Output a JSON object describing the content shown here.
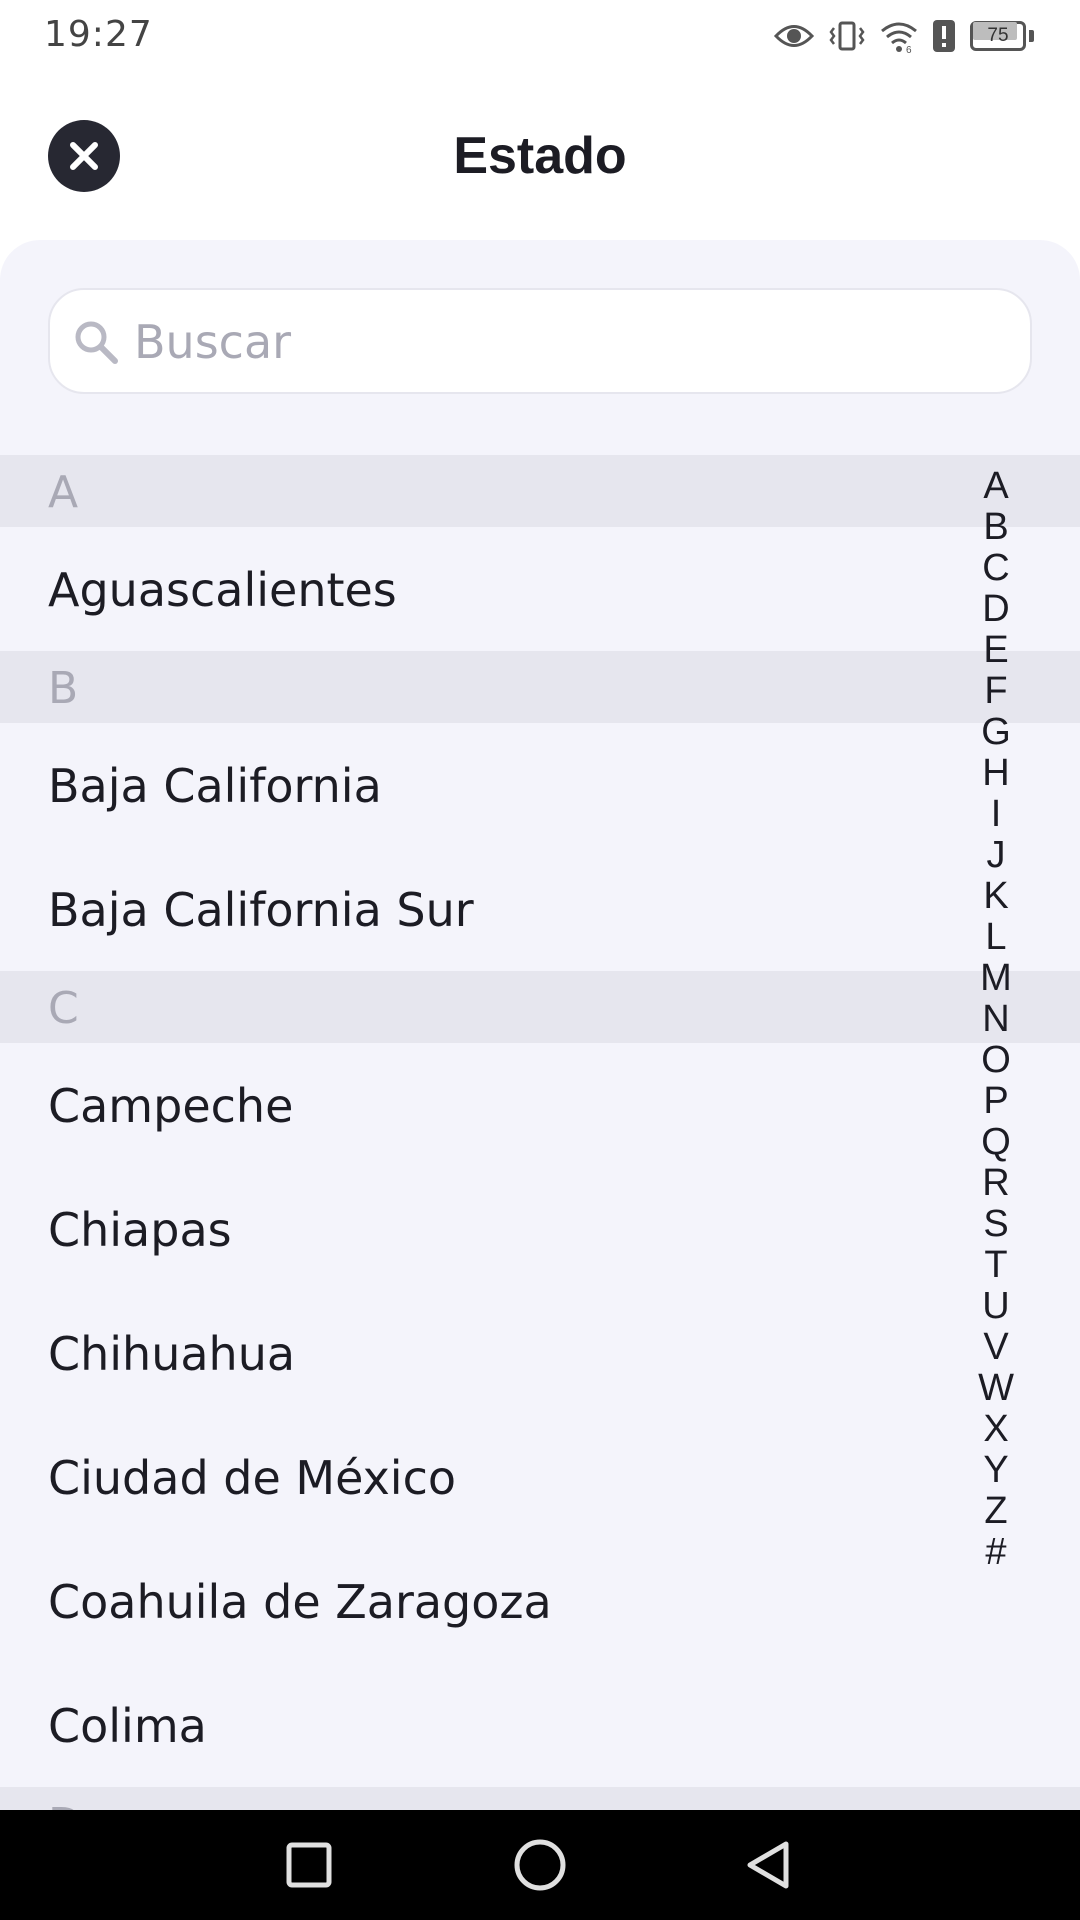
{
  "status_bar": {
    "time": "19:27",
    "battery_level": "75",
    "icons": [
      "eye-icon",
      "vibrate-icon",
      "wifi-icon",
      "alert-icon",
      "battery-icon"
    ]
  },
  "header": {
    "title": "Estado",
    "close_icon": "close-icon"
  },
  "search": {
    "placeholder": "Buscar",
    "value": ""
  },
  "sections": [
    {
      "letter": "A",
      "items": [
        "Aguascalientes"
      ]
    },
    {
      "letter": "B",
      "items": [
        "Baja California",
        "Baja California Sur"
      ]
    },
    {
      "letter": "C",
      "items": [
        "Campeche",
        "Chiapas",
        "Chihuahua",
        "Ciudad de México",
        "Coahuila de Zaragoza",
        "Colima"
      ]
    },
    {
      "letter": "D",
      "items": []
    }
  ],
  "alpha_index": [
    "A",
    "B",
    "C",
    "D",
    "E",
    "F",
    "G",
    "H",
    "I",
    "J",
    "K",
    "L",
    "M",
    "N",
    "O",
    "P",
    "Q",
    "R",
    "S",
    "T",
    "U",
    "V",
    "W",
    "X",
    "Y",
    "Z",
    "#"
  ],
  "nav_bar": {
    "buttons": [
      "recent-apps-icon",
      "home-icon",
      "back-icon"
    ]
  },
  "colors": {
    "panel_bg": "#f4f4fb",
    "section_bg": "#e6e6ee",
    "close_button": "#272832",
    "text": "#1c1c24",
    "muted": "#a9a9b5"
  }
}
